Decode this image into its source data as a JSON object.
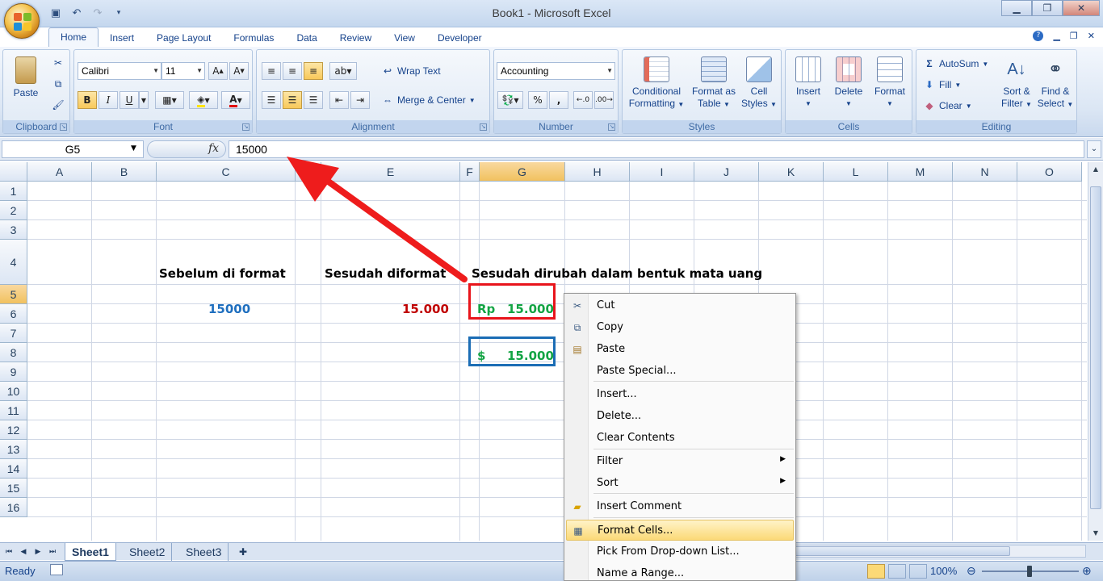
{
  "window": {
    "title": "Book1 - Microsoft Excel",
    "controls": [
      "minimize",
      "restore",
      "close"
    ]
  },
  "quick_access": [
    "save-icon",
    "undo-icon",
    "redo-icon",
    "customize-icon"
  ],
  "tabs": [
    "Home",
    "Insert",
    "Page Layout",
    "Formulas",
    "Data",
    "Review",
    "View",
    "Developer"
  ],
  "active_tab": "Home",
  "ribbon": {
    "clipboard": {
      "label": "Clipboard",
      "paste": "Paste"
    },
    "font": {
      "label": "Font",
      "name": "Calibri",
      "size": "11",
      "bold": "B",
      "italic": "I",
      "underline": "U"
    },
    "alignment": {
      "label": "Alignment",
      "wrap_text": "Wrap Text",
      "merge_center": "Merge & Center"
    },
    "number": {
      "label": "Number",
      "format": "Accounting",
      "percent": "%",
      "comma": ","
    },
    "styles": {
      "label": "Styles",
      "conditional_l1": "Conditional",
      "conditional_l2": "Formatting",
      "format_table_l1": "Format as",
      "format_table_l2": "Table",
      "cell_styles_l1": "Cell",
      "cell_styles_l2": "Styles"
    },
    "cells": {
      "label": "Cells",
      "insert": "Insert",
      "delete": "Delete",
      "format": "Format"
    },
    "editing": {
      "label": "Editing",
      "autosum": "AutoSum",
      "fill": "Fill",
      "clear": "Clear",
      "sort_l1": "Sort &",
      "sort_l2": "Filter",
      "find_l1": "Find &",
      "find_l2": "Select"
    }
  },
  "formula_bar": {
    "name_box": "G5",
    "fx": "fx",
    "value": "15000"
  },
  "columns": [
    "A",
    "B",
    "C",
    "D",
    "E",
    "F",
    "G",
    "H",
    "I",
    "J",
    "K",
    "L",
    "M",
    "N",
    "O"
  ],
  "rows": [
    "1",
    "2",
    "3",
    "4",
    "5",
    "6",
    "7",
    "8",
    "9",
    "10",
    "11",
    "12",
    "13",
    "14",
    "15",
    "16"
  ],
  "selected_cell": "G5",
  "cells": {
    "C4": "Sebelum di format",
    "E4": "Sesudah diformat",
    "G4": "Sesudah dirubah dalam bentuk mata uang",
    "C5": "15000",
    "E5": "15.000",
    "G5_symbol": "Rp",
    "G5_value": "15.000",
    "G7_symbol": "$",
    "G7_value": "15.000"
  },
  "colors": {
    "blue_value": "#1f6fbf",
    "red_value": "#c00000",
    "green_value": "#13a444",
    "red_box": "#e8141b",
    "blue_box": "#1b6db5",
    "arrow": "#ee1c1c"
  },
  "context_menu": [
    {
      "label": "Cut",
      "icon": "scissors-icon"
    },
    {
      "label": "Copy",
      "icon": "copy-icon"
    },
    {
      "label": "Paste",
      "icon": "paste-icon"
    },
    {
      "label": "Paste Special..."
    },
    {
      "label": "Insert..."
    },
    {
      "label": "Delete..."
    },
    {
      "label": "Clear Contents"
    },
    {
      "label": "Filter",
      "submenu": true
    },
    {
      "label": "Sort",
      "submenu": true
    },
    {
      "label": "Insert Comment",
      "icon": "comment-icon"
    },
    {
      "label": "Format Cells...",
      "icon": "format-cells-icon",
      "highlighted": true
    },
    {
      "label": "Pick From Drop-down List..."
    },
    {
      "label": "Name a Range..."
    }
  ],
  "sheets": [
    "Sheet1",
    "Sheet2",
    "Sheet3"
  ],
  "active_sheet": "Sheet1",
  "status": {
    "mode": "Ready",
    "zoom": "100%"
  }
}
